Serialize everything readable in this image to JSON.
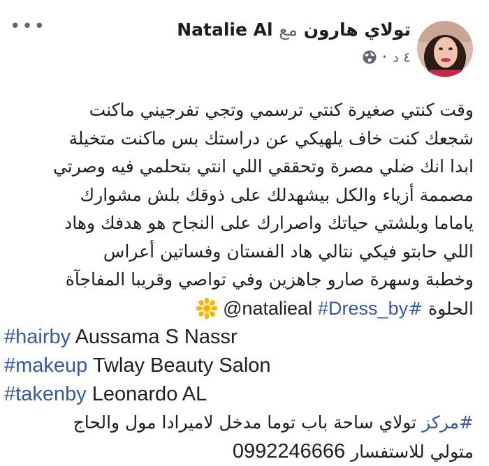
{
  "header": {
    "author": "تولاي هارون",
    "with_word": "مع",
    "tagged": "Natalie Al",
    "timestamp": "٤ د",
    "dot": "•",
    "more_label": "•••"
  },
  "body": {
    "lines": [
      "وقت كنتي صغيرة كنتي ترسمي وتجي تفرجيني ماكنت",
      "شجعك كنت خاف يلهيكي عن دراستك بس ماكنت متخيلة",
      "ابدا انك ضلي مصرة وتحققي اللي انتي بتحلمي فيه وصرتي",
      "مصممة أزياء والكل بيشهدلك على ذوقك  بلش مشوارك",
      "ياماما وبلشتي حياتك واصرارك على النجاح هو هدفك وهاد",
      "اللي حابتو فيكي نتالي هاد الفستان وفساتين أعراس",
      "وخطبة وسهرة صارو جاهزين وفي تواصي  وقريبا المفاجآة"
    ],
    "last_line_prefix": "الحلوة",
    "dress_tag": "#Dress_by",
    "mention": "@natalieal",
    "hash_sign": "#",
    "credits": [
      {
        "tag": "#hairby",
        "text": " Aussama S Nassr"
      },
      {
        "tag": "#makeup",
        "text": " Twlay Beauty Salon"
      },
      {
        "tag": "#takenby",
        "text": " Leonardo AL"
      }
    ],
    "center_tag": "#مركز",
    "center_text": " تولاي ساحة باب توما مدخل لاميرادا مول والحاج",
    "contact_text": "متولي للاستفسار ",
    "phone": "0992246666"
  },
  "colors": {
    "link": "#385898",
    "text": "#1c1e21",
    "meta": "#606770"
  },
  "icons": {
    "globe": "globe-icon",
    "more": "more-options-icon",
    "sun": "sunflower-emoji-icon"
  }
}
